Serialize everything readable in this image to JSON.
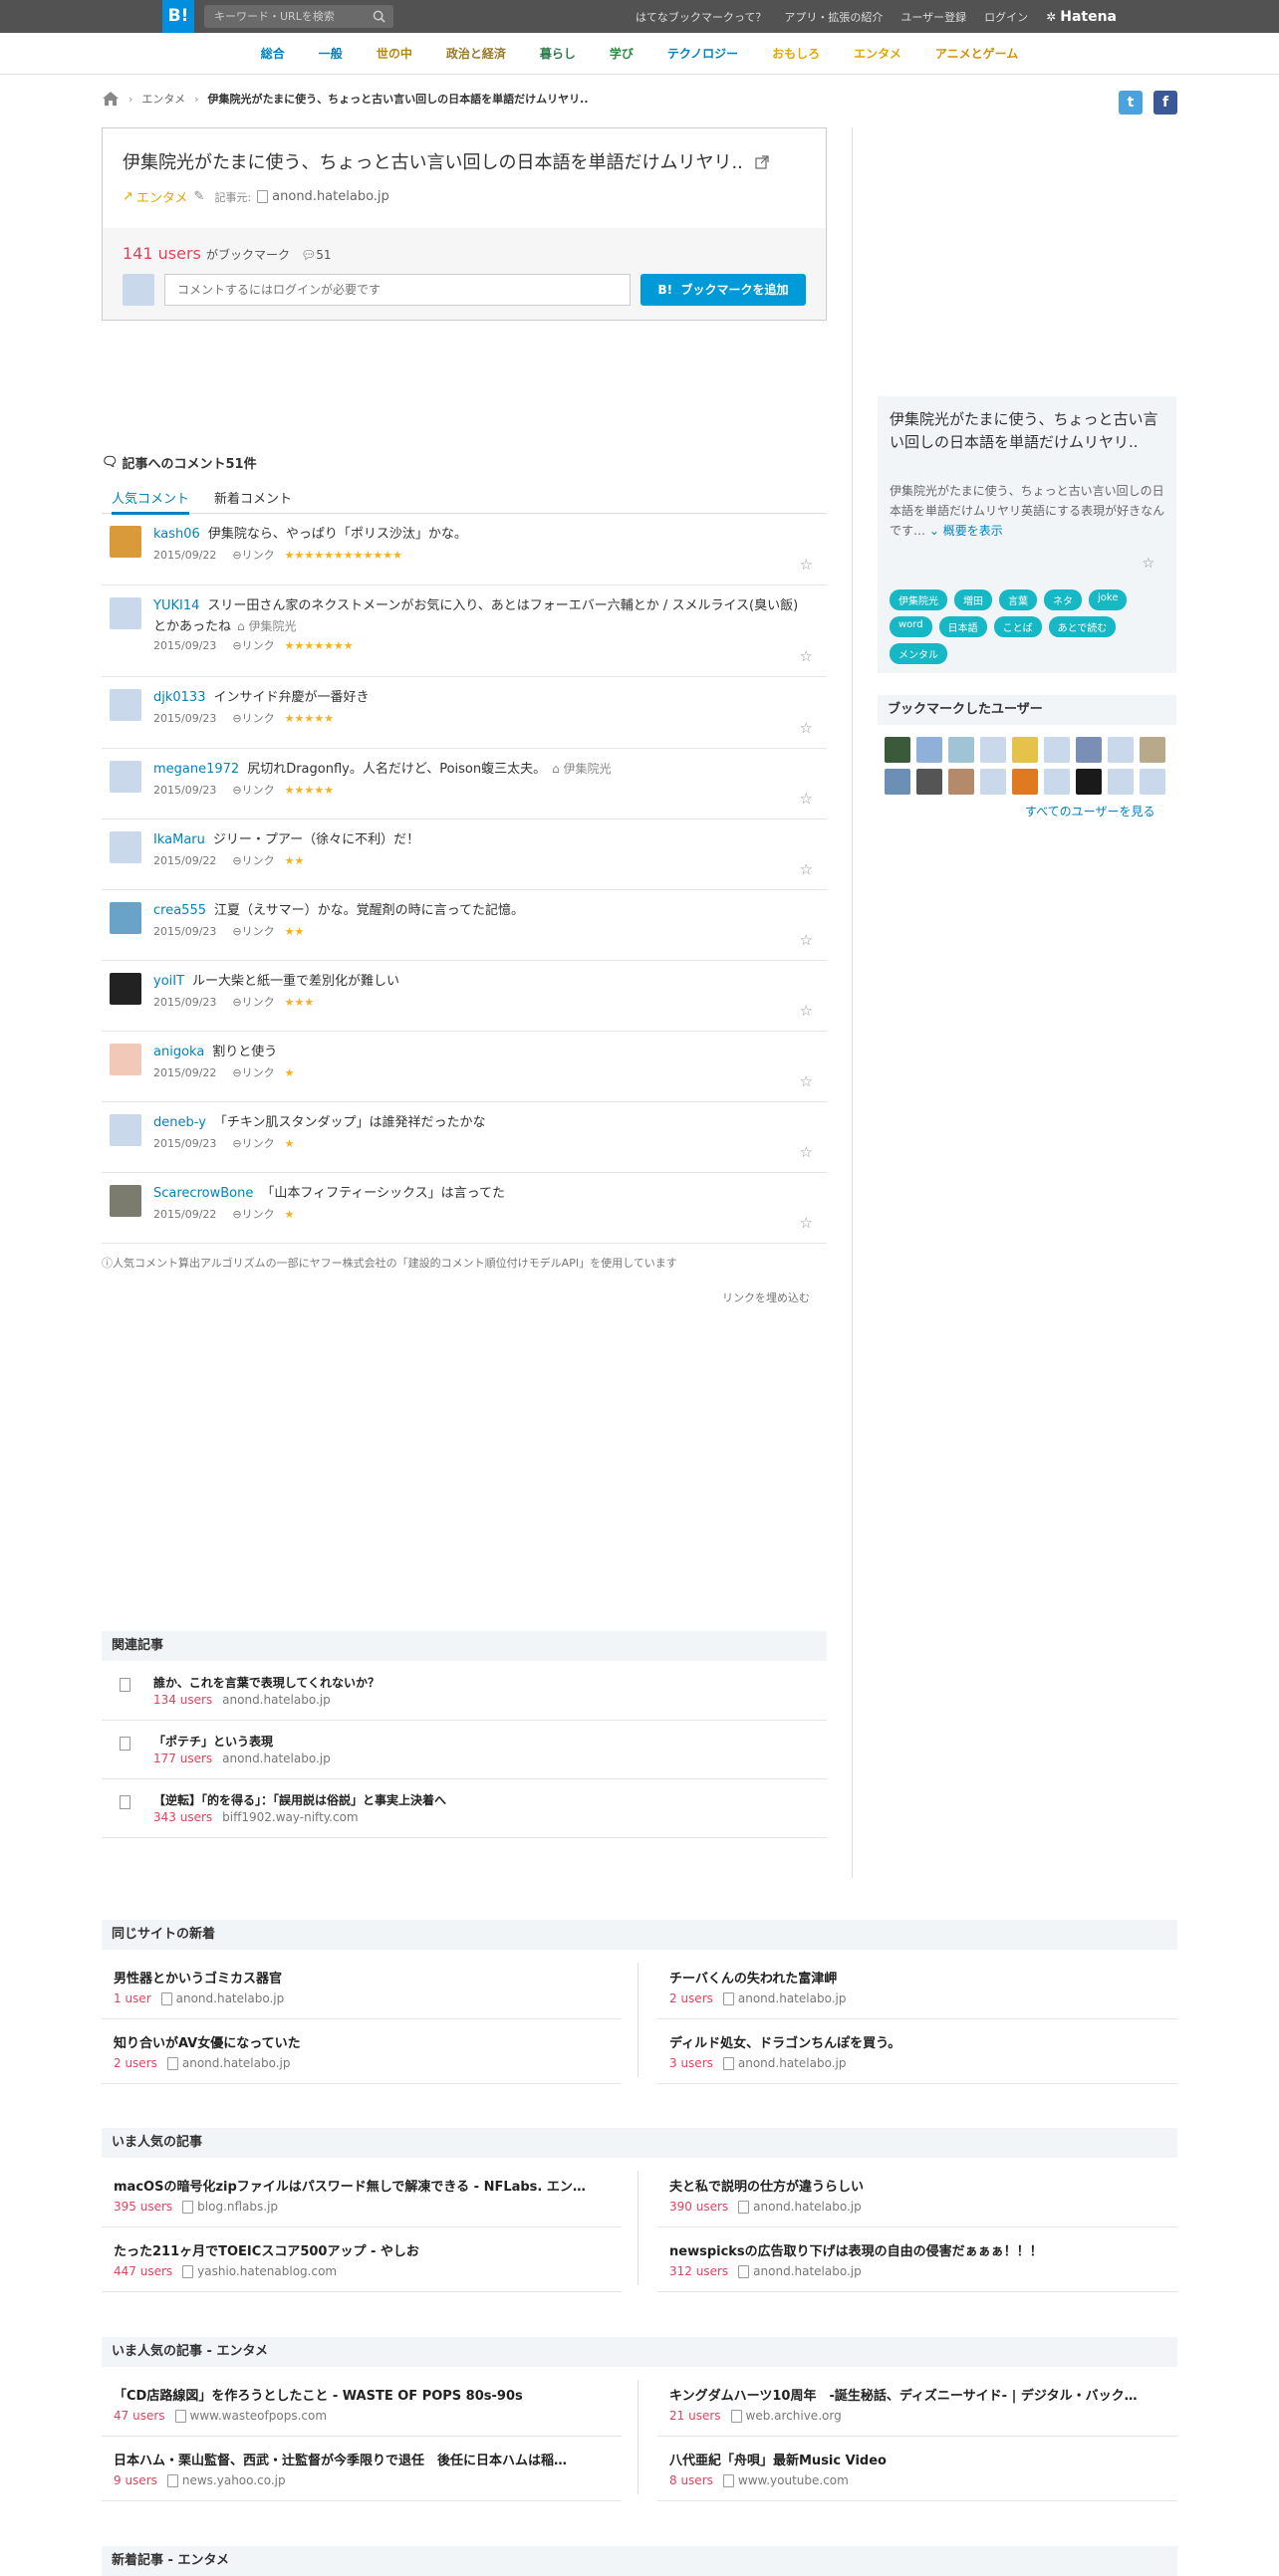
{
  "header": {
    "logo": "B!",
    "search_placeholder": "キーワード・URLを検索",
    "links": [
      "はてなブックマークって？",
      "アプリ・拡張の紹介",
      "ユーザー登録",
      "ログイン"
    ],
    "hatena": "Hatena"
  },
  "categories": [
    {
      "label": "総合",
      "color": "#0083c1"
    },
    {
      "label": "一般",
      "color": "#0083c1"
    },
    {
      "label": "世の中",
      "color": "#b8860b"
    },
    {
      "label": "政治と経済",
      "color": "#9a7b2a"
    },
    {
      "label": "暮らし",
      "color": "#2f7d4f"
    },
    {
      "label": "学び",
      "color": "#2a8a3e"
    },
    {
      "label": "テクノロジー",
      "color": "#0083c1"
    },
    {
      "label": "おもしろ",
      "color": "#e0a800"
    },
    {
      "label": "エンタメ",
      "color": "#e0a800"
    },
    {
      "label": "アニメとゲーム",
      "color": "#d68f00"
    }
  ],
  "breadcrumb": {
    "category": "エンタメ",
    "current": "伊集院光がたまに使う、ちょっと古い言い回しの日本語を単語だけムリヤリ.."
  },
  "share": {
    "twitter": "t",
    "facebook": "f"
  },
  "entry": {
    "title": "伊集院光がたまに使う、ちょっと古い言い回しの日本語を単語だけムリヤリ..",
    "category": "エンタメ",
    "source_label": "記事元:",
    "source": "anond.hatelabo.jp",
    "users": "141 users",
    "users_suffix": "がブックマーク",
    "comment_count": "51",
    "comment_placeholder": "コメントするにはログインが必要です",
    "bookmark_button": "ブックマークを追加"
  },
  "comments_section": {
    "heading": "記事へのコメント51件",
    "tab_popular": "人気コメント",
    "tab_new": "新着コメント",
    "link_label": "リンク",
    "items": [
      {
        "user": "kash06",
        "text": "伊集院なら、やっぱり「ポリス沙汰」かな。",
        "tag": "",
        "date": "2015/09/22",
        "stars": "★★★★★★★★★★★★",
        "avatar": "#d99a3a"
      },
      {
        "user": "YUKI14",
        "text": "スリー田さん家のネクストメーンがお気に入り、あとはフォーエバー六輔とか / スメルライス(臭い飯)とかあったね",
        "tag": "伊集院光",
        "date": "2015/09/23",
        "stars": "★★★★★★★",
        "avatar": "#c9d8ea"
      },
      {
        "user": "djk0133",
        "text": "インサイド弁慶が一番好き",
        "tag": "",
        "date": "2015/09/23",
        "stars": "★★★★★",
        "avatar": "#c9d8ea"
      },
      {
        "user": "megane1972",
        "text": "尻切れDragonfly。人名だけど、Poison蝮三太夫。",
        "tag": "伊集院光",
        "date": "2015/09/23",
        "stars": "★★★★★",
        "avatar": "#c9d8ea"
      },
      {
        "user": "IkaMaru",
        "text": "ジリー・プアー（徐々に不利）だ！",
        "tag": "",
        "date": "2015/09/22",
        "stars": "★★",
        "avatar": "#c9d8ea"
      },
      {
        "user": "crea555",
        "text": "江夏（えサマー）かな。覚醒剤の時に言ってた記憶。",
        "tag": "",
        "date": "2015/09/23",
        "stars": "★★",
        "avatar": "#6aa3c8"
      },
      {
        "user": "yoiIT",
        "text": "ルー大柴と紙一重で差別化が難しい",
        "tag": "",
        "date": "2015/09/23",
        "stars": "★★★",
        "avatar": "#222222"
      },
      {
        "user": "anigoka",
        "text": "割りと使う",
        "tag": "",
        "date": "2015/09/22",
        "stars": "★",
        "avatar": "#f2c9b8"
      },
      {
        "user": "deneb-y",
        "text": "「チキン肌スタンダップ」は誰発祥だったかな",
        "tag": "",
        "date": "2015/09/23",
        "stars": "★",
        "avatar": "#c9d8ea"
      },
      {
        "user": "ScarecrowBone",
        "text": "「山本フィフティーシックス」は言ってた",
        "tag": "",
        "date": "2015/09/22",
        "stars": "★",
        "avatar": "#7b7b6e"
      }
    ],
    "footnote": "ⓘ人気コメント算出アルゴリズムの一部にヤフー株式会社の「建設的コメント順位付けモデルAPI」を使用しています",
    "embed": "リンクを埋め込む"
  },
  "sidebar": {
    "title": "伊集院光がたまに使う、ちょっと古い言い回しの日本語を単語だけムリヤリ..",
    "desc": "伊集院光がたまに使う、ちょっと古い言い回しの日本語を単語だけムリヤリ英語にする表現が好きなんです…",
    "more": "概要を表示",
    "tags": [
      "伊集院光",
      "増田",
      "言葉",
      "ネタ",
      "joke",
      "word",
      "日本語",
      "ことば",
      "あとで読む",
      "メンタル"
    ],
    "users_heading": "ブックマークしたユーザー",
    "user_colors": [
      "#3a5a3a",
      "#8fb0d8",
      "#9fc4d6",
      "#c9d8ea",
      "#e7c24a",
      "#c9d8ea",
      "#7a8fb5",
      "#c9d8ea",
      "#b8a98a",
      "#6b8fb5",
      "#555555",
      "#b58a6a",
      "#c9d8ea",
      "#e07a20",
      "#c9d8ea",
      "#1a1a1a",
      "#c9d8ea",
      "#c9d8ea"
    ],
    "all_users": "すべてのユーザーを見る"
  },
  "related": {
    "heading": "関連記事",
    "items": [
      {
        "title": "誰か、これを言葉で表現してくれないか？",
        "users": "134 users",
        "source": "anond.hatelabo.jp"
      },
      {
        "title": "「ポテチ」という表現",
        "users": "177 users",
        "source": "anond.hatelabo.jp"
      },
      {
        "title": "【逆転】「的を得る」：「誤用説は俗説」と事実上決着へ",
        "users": "343 users",
        "source": "biff1902.way-nifty.com"
      }
    ]
  },
  "same_site": {
    "heading": "同じサイトの新着",
    "items": [
      {
        "title": "男性器とかいうゴミカス器官",
        "users": "1 user",
        "source": "anond.hatelabo.jp"
      },
      {
        "title": "チーバくんの失われた富津岬",
        "users": "2 users",
        "source": "anond.hatelabo.jp"
      },
      {
        "title": "知り合いがAV女優になっていた",
        "users": "2 users",
        "source": "anond.hatelabo.jp"
      },
      {
        "title": "ディルド処女、ドラゴンちんぽを買う。",
        "users": "3 users",
        "source": "anond.hatelabo.jp"
      }
    ]
  },
  "popular": {
    "heading": "いま人気の記事",
    "items": [
      {
        "title": "macOSの暗号化zipファイルはパスワード無しで解凍できる - NFLabs. エン…",
        "users": "395 users",
        "source": "blog.nflabs.jp"
      },
      {
        "title": "夫と私で説明の仕方が違うらしい",
        "users": "390 users",
        "source": "anond.hatelabo.jp"
      },
      {
        "title": "たった211ヶ月でTOEICスコア500アップ - やしお",
        "users": "447 users",
        "source": "yashio.hatenablog.com"
      },
      {
        "title": "newspicksの広告取り下げは表現の自由の侵害だぁぁぁ！！！",
        "users": "312 users",
        "source": "anond.hatelabo.jp"
      }
    ]
  },
  "popular_ent": {
    "heading": "いま人気の記事 - エンタメ",
    "items": [
      {
        "title": "「CD店路線図」を作ろうとしたこと - WASTE OF POPS 80s-90s",
        "users": "47 users",
        "source": "www.wasteofpops.com"
      },
      {
        "title": "キングダムハーツ10周年　-誕生秘話、ディズニーサイド- | デジタル・バック…",
        "users": "21 users",
        "source": "web.archive.org"
      },
      {
        "title": "日本ハム・栗山監督、西武・辻監督が今季限りで退任　後任に日本ハムは稲…",
        "users": "9 users",
        "source": "news.yahoo.co.jp"
      },
      {
        "title": "八代亜紀「舟唄」最新Music Video",
        "users": "8 users",
        "source": "www.youtube.com"
      }
    ]
  },
  "new_ent": {
    "heading": "新着記事 - エンタメ"
  }
}
